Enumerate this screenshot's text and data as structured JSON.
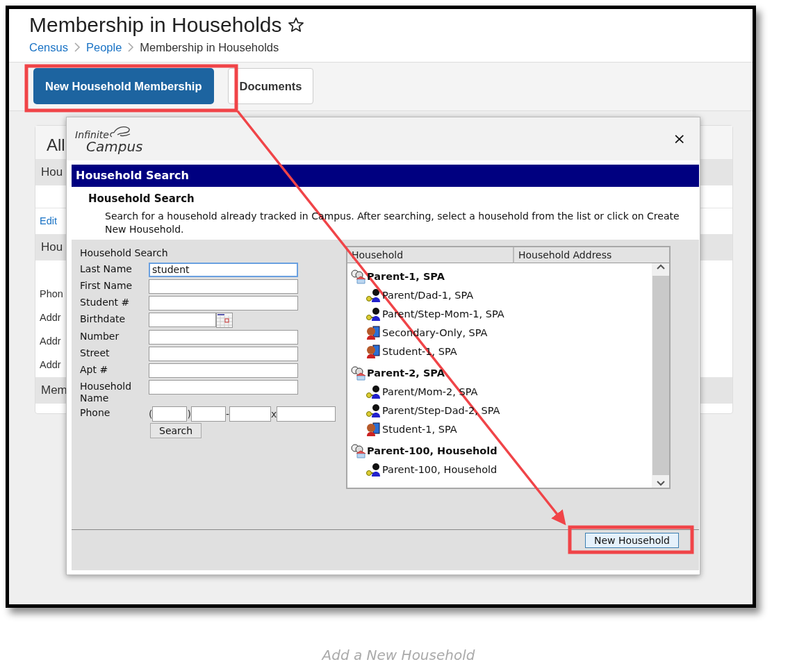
{
  "page": {
    "title": "Membership in Households",
    "breadcrumb": [
      {
        "label": "Census",
        "link": true
      },
      {
        "label": "People",
        "link": true
      },
      {
        "label": "Membership in Households",
        "link": false
      }
    ],
    "toolbar": [
      {
        "label": "New Household Membership",
        "kind": "primary"
      },
      {
        "label": "Documents",
        "kind": "secondary"
      }
    ],
    "background_panel": {
      "title": "All",
      "rows": [
        {
          "kind": "header",
          "text": "Hou"
        },
        {
          "kind": "blank"
        },
        {
          "kind": "link",
          "text": "Edit"
        },
        {
          "kind": "header",
          "text": "Hou"
        },
        {
          "kind": "blank"
        },
        {
          "kind": "text",
          "text": "Phon"
        },
        {
          "kind": "text",
          "text": "Addr"
        },
        {
          "kind": "text",
          "text": "Addr"
        },
        {
          "kind": "text",
          "text": "Addr"
        },
        {
          "kind": "header",
          "text": "Mem"
        }
      ]
    }
  },
  "dialog": {
    "logo": {
      "line1": "Infinite",
      "line2": "Campus"
    },
    "close": "×",
    "banner": "Household Search",
    "subtitle": "Household Search",
    "description": "Search for a household already tracked in Campus. After searching, select a household from the list or click on Create New Household.",
    "form": {
      "title": "Household Search",
      "fields": [
        {
          "label": "Last Name",
          "kind": "text",
          "value": "student",
          "focused": true
        },
        {
          "label": "First Name",
          "kind": "text",
          "focused": false
        },
        {
          "label": "Student #",
          "kind": "text",
          "focused": false
        },
        {
          "label": "Birthdate",
          "kind": "date",
          "focused": false
        },
        {
          "label": "Number",
          "kind": "text",
          "focused": false
        },
        {
          "label": "Street",
          "kind": "text",
          "focused": false
        },
        {
          "label": "Apt #",
          "kind": "text",
          "focused": false
        },
        {
          "label": "Household Name",
          "kind": "text",
          "focused": false
        }
      ],
      "phone": {
        "label": "Phone",
        "separators": [
          "(",
          ")",
          "-",
          "x"
        ]
      },
      "search_button": "Search"
    },
    "results": {
      "columns": [
        "Household",
        "Household Address"
      ],
      "households": [
        {
          "name": "Parent-1, SPA",
          "members": [
            {
              "name": "Parent/Dad-1, SPA",
              "kind": "guardian"
            },
            {
              "name": "Parent/Step-Mom-1, SPA",
              "kind": "guardian"
            },
            {
              "name": "Secondary-Only, SPA",
              "kind": "student"
            },
            {
              "name": "Student-1, SPA",
              "kind": "student"
            }
          ]
        },
        {
          "name": "Parent-2, SPA",
          "members": [
            {
              "name": "Parent/Mom-2, SPA",
              "kind": "guardian"
            },
            {
              "name": "Parent/Step-Dad-2, SPA",
              "kind": "guardian"
            },
            {
              "name": "Student-1, SPA",
              "kind": "student"
            }
          ]
        },
        {
          "name": "Parent-100, Household",
          "members": [
            {
              "name": "Parent-100, Household",
              "kind": "guardian"
            }
          ]
        }
      ]
    },
    "footer_button": "New Household"
  },
  "caption": "Add a New Household"
}
